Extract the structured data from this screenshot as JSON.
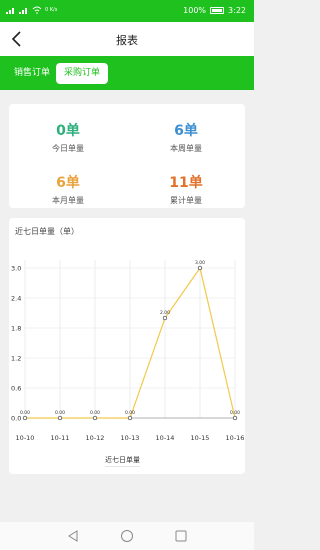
{
  "status": {
    "carrier_icons": "signal-icons",
    "speed": "0 K/s",
    "battery": "100%",
    "time": "3:22"
  },
  "nav": {
    "title": "报表"
  },
  "tabs": [
    {
      "label": "销售订单",
      "active": false
    },
    {
      "label": "采购订单",
      "active": true
    }
  ],
  "stats": [
    {
      "value": "0单",
      "label": "今日单量",
      "color": "#2eaf7d"
    },
    {
      "value": "6单",
      "label": "本周单量",
      "color": "#3d8fd1"
    },
    {
      "value": "6单",
      "label": "本月单量",
      "color": "#e8a33d"
    },
    {
      "value": "11单",
      "label": "累计单量",
      "color": "#e0722b"
    }
  ],
  "chart": {
    "title": "近七日单量（单）",
    "legend": "近七日单量"
  },
  "chart_data": {
    "type": "line",
    "categories": [
      "10-10",
      "10-11",
      "10-12",
      "10-13",
      "10-14",
      "10-15",
      "10-16"
    ],
    "series": [
      {
        "name": "近七日单量",
        "values": [
          0,
          0,
          0,
          0,
          2,
          3,
          0
        ]
      }
    ],
    "point_labels": [
      "0.00",
      "0.00",
      "0.00",
      "0.00",
      "2.00",
      "3.00",
      "0.00"
    ],
    "yticks": [
      "0.0",
      "0.6",
      "1.2",
      "1.8",
      "2.4",
      "3.0"
    ],
    "ylim": [
      0,
      3
    ],
    "grid": true,
    "line_color": "#f2c94c"
  }
}
